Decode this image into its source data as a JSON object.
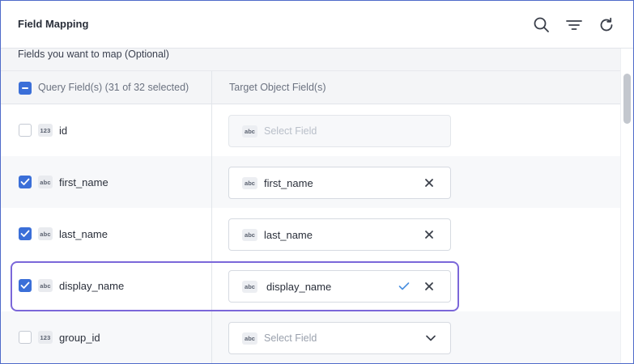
{
  "header": {
    "title": "Field Mapping",
    "icons": [
      "search-icon",
      "filter-icon",
      "refresh-icon"
    ]
  },
  "section": {
    "label": "Fields you want to map (Optional)"
  },
  "columns": {
    "query_label": "Query Field(s) (31 of 32 selected)",
    "target_label": "Target Object Field(s)"
  },
  "rows": [
    {
      "checked": false,
      "type": "123",
      "name": "id",
      "target": {
        "type": "abc",
        "value": "",
        "placeholder": "Select Field",
        "state": "disabled"
      }
    },
    {
      "checked": true,
      "type": "abc",
      "name": "first_name",
      "target": {
        "type": "abc",
        "value": "first_name",
        "placeholder": "",
        "state": "selected"
      }
    },
    {
      "checked": true,
      "type": "abc",
      "name": "last_name",
      "target": {
        "type": "abc",
        "value": "last_name",
        "placeholder": "",
        "state": "selected"
      }
    },
    {
      "checked": true,
      "type": "abc",
      "name": "display_name",
      "target": {
        "type": "abc",
        "value": "display_name",
        "placeholder": "",
        "state": "confirmed"
      }
    },
    {
      "checked": false,
      "type": "123",
      "name": "group_id",
      "target": {
        "type": "abc",
        "value": "",
        "placeholder": "Select Field",
        "state": "dropdown"
      }
    }
  ],
  "colors": {
    "accent": "#3b6fd8",
    "highlight": "#7b67d9",
    "frame_border": "#4f6bc9"
  }
}
